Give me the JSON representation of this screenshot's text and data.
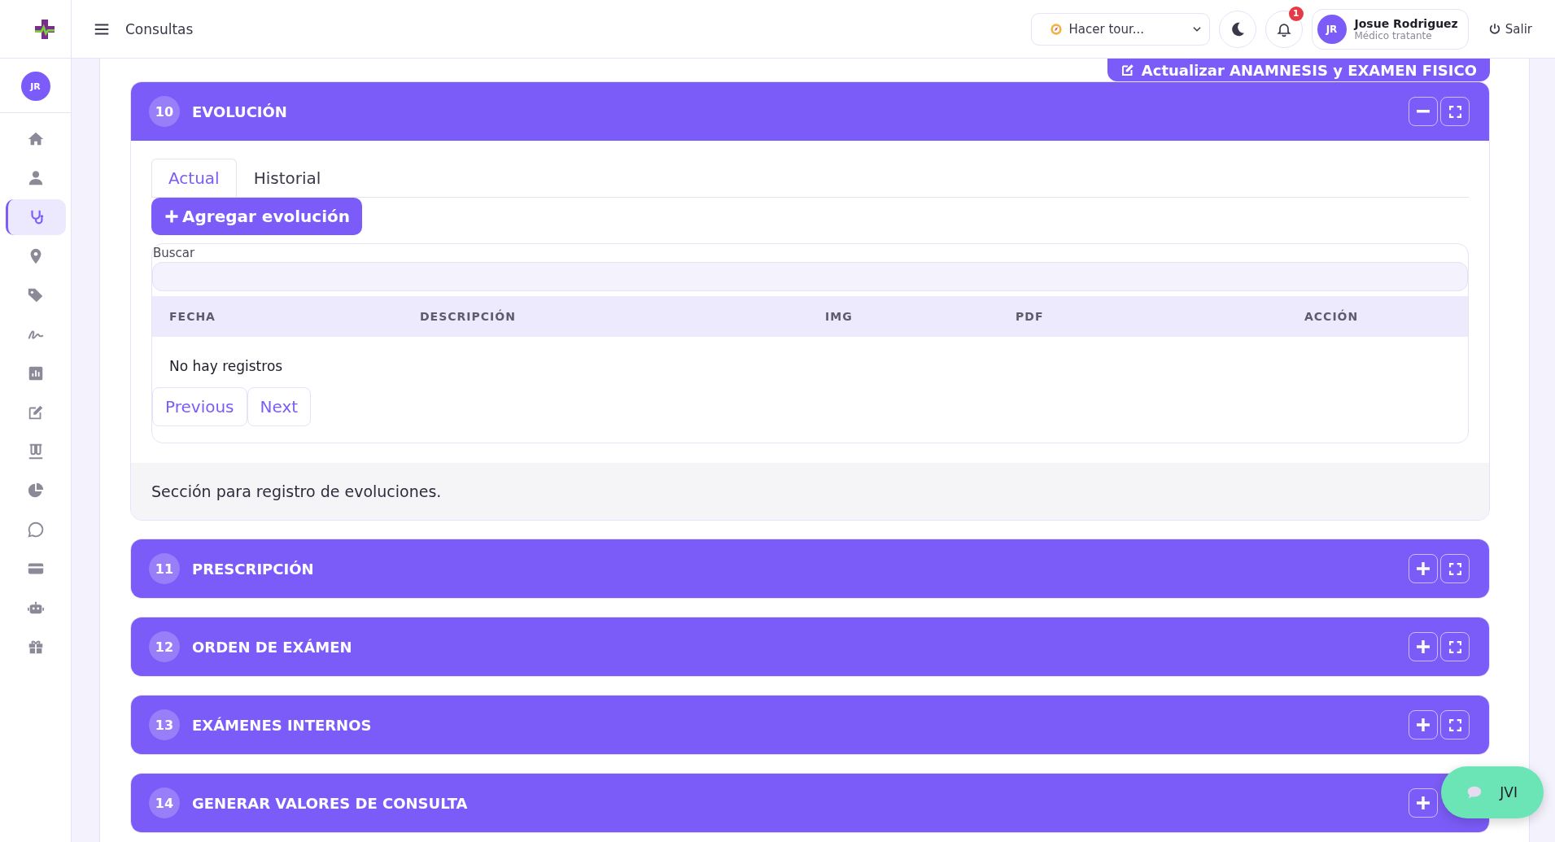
{
  "topbar": {
    "title": "Consultas",
    "tour_select": "Hacer tour...",
    "notifications_count": "1",
    "user": {
      "initials": "JR",
      "name": "Josue Rodriguez",
      "role": "Médico tratante"
    },
    "logout": "Salir"
  },
  "sidebar": {
    "avatar": "JR",
    "items": [
      {
        "selected": false
      },
      {
        "selected": false
      },
      {
        "selected": true
      },
      {
        "selected": false
      },
      {
        "selected": false
      },
      {
        "selected": false
      },
      {
        "selected": false
      },
      {
        "selected": false
      },
      {
        "selected": false
      },
      {
        "selected": false
      },
      {
        "selected": false
      },
      {
        "selected": false
      },
      {
        "selected": false
      },
      {
        "selected": false
      }
    ]
  },
  "update_button": "Actualizar ANAMNESIS y EXAMEN FISICO",
  "sections": [
    {
      "number": "10",
      "title": "EVOLUCIÓN",
      "expanded": true,
      "tabs": [
        {
          "label": "Actual",
          "selected": true
        },
        {
          "label": "Historial",
          "selected": false
        }
      ],
      "add_button": "Agregar evolución",
      "search_label": "Buscar",
      "columns": [
        "FECHA",
        "DESCRIPCIÓN",
        "IMG",
        "PDF",
        "ACCIÓN"
      ],
      "empty_message": "No hay registros",
      "pagination": [
        "Previous",
        "Next"
      ],
      "footer": "Sección para registro de evoluciones."
    },
    {
      "number": "11",
      "title": "PRESCRIPCIÓN",
      "expanded": false
    },
    {
      "number": "12",
      "title": "ORDEN DE EXÁMEN",
      "expanded": false
    },
    {
      "number": "13",
      "title": "EXÁMENES INTERNOS",
      "expanded": false
    },
    {
      "number": "14",
      "title": "GENERAR VALORES DE CONSULTA",
      "expanded": false
    }
  ],
  "chat_button": "JVI"
}
